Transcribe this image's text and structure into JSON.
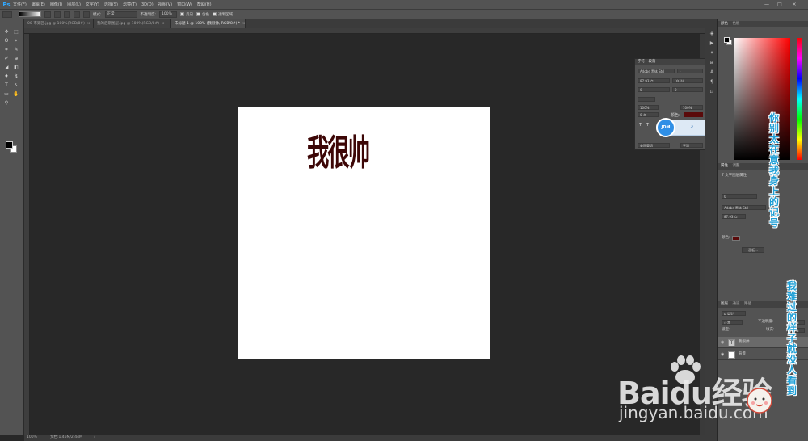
{
  "app": {
    "logo": "Ps"
  },
  "menu": [
    "文件(F)",
    "编辑(E)",
    "图像(I)",
    "图层(L)",
    "文字(Y)",
    "选择(S)",
    "滤镜(T)",
    "3D(D)",
    "视图(V)",
    "窗口(W)",
    "帮助(H)"
  ],
  "window_controls": [
    "—",
    "□",
    "×"
  ],
  "options_bar": {
    "mode_label": "模式:",
    "mode_value": "正常",
    "opacity_label": "不透明度:",
    "opacity_value": "100%",
    "reverse_label": "反向",
    "dither_label": "仿色",
    "transparency_label": "透明区域"
  },
  "tabs": [
    {
      "label": "00-市第区.jpg @ 100%(RGB/8#)",
      "close": "×",
      "active": false
    },
    {
      "label": "我的后期图层.jpg @ 100%(RGB/8#)",
      "close": "×",
      "active": false
    },
    {
      "label": "未标题-1 @ 100% (我很帅, RGB/8#) *",
      "close": "×",
      "active": true
    }
  ],
  "tools": [
    "✥",
    "⬚",
    "ʘ",
    "⌖",
    "⌗",
    "✎",
    "✐",
    "⊕",
    "◢",
    "◧",
    "♦",
    "↯",
    "T",
    "↖",
    "▭",
    "✋",
    "⚲"
  ],
  "canvas": {
    "text": "我很帅",
    "text_color": "#3d0707"
  },
  "status": {
    "zoom": "100%",
    "info": "文档:1.46M/2.44M",
    "arrow": "›"
  },
  "dock_icons": [
    "◈",
    "▶",
    "✦",
    "⊞",
    "A",
    "¶",
    "⊡"
  ],
  "color_panel": {
    "tabs": [
      "颜色",
      "色板"
    ]
  },
  "properties_panel": {
    "tabs": [
      "属性",
      "调整"
    ],
    "title": "文字图层属性",
    "font": "Adobe 黑体 Std",
    "size": "87.93 点",
    "tracking": "0",
    "color_label": "颜色:",
    "button": "画板..."
  },
  "character_panel": {
    "tabs": [
      "字符",
      "段落"
    ],
    "font": "Adobe 黑体 Std",
    "style": "-",
    "size": "87.93 点",
    "leading": "(自动)",
    "kerning": "0",
    "tracking": "0",
    "scale_v": "100%",
    "scale_h": "100%",
    "baseline": "0 点",
    "color_label": "颜色:",
    "language": "美国英语",
    "aa": "平滑"
  },
  "layers_panel": {
    "tabs": [
      "图层",
      "通道",
      "路径"
    ],
    "kind": "ρ 类型",
    "blend": "正常",
    "opacity_label": "不透明度:",
    "opacity": "100%",
    "lock_label": "锁定:",
    "fill_label": "填充:",
    "fill": "100%",
    "layers": [
      {
        "name": "我很帅",
        "thumb": "T",
        "selected": true
      },
      {
        "name": "背景",
        "thumb": "",
        "selected": false
      }
    ]
  },
  "jdm_overlay": {
    "label": "JDM",
    "tooltip": "要查看项",
    "badge": "99+"
  },
  "watermark": {
    "line1": [
      "你",
      "别",
      "太",
      "在",
      "意",
      "我",
      "身",
      "上",
      "的",
      "记",
      "号"
    ],
    "line2": [
      "我",
      "难",
      "过",
      "的",
      "样",
      "子",
      "就",
      "没",
      "人",
      "看",
      "到"
    ],
    "baidu": "Baidu经验",
    "url": "jingyan.baidu.com"
  }
}
